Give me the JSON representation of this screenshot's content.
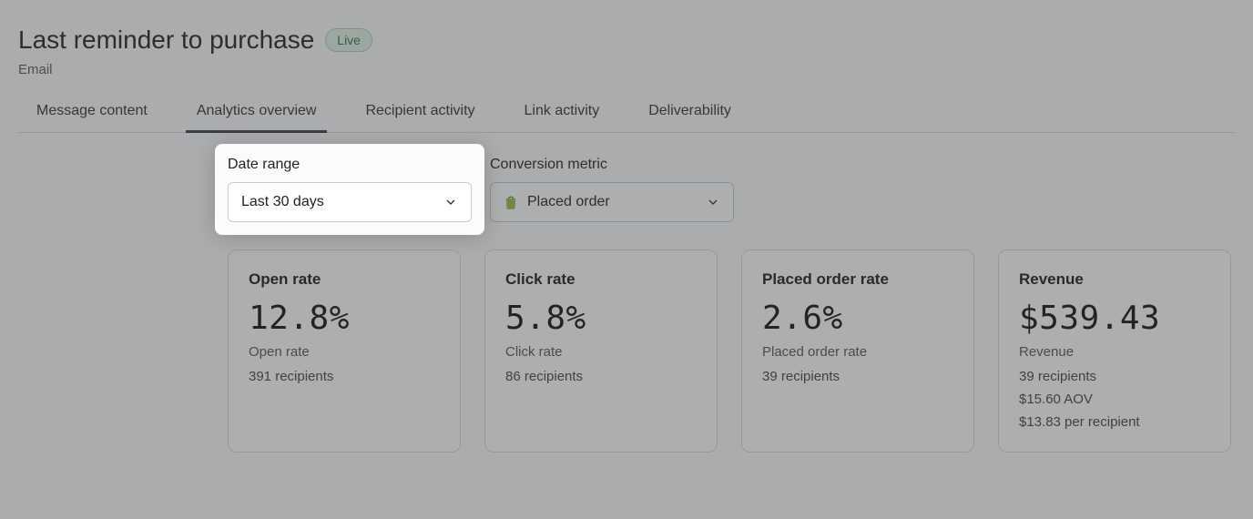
{
  "header": {
    "title": "Last reminder to purchase",
    "status_badge": "Live",
    "channel": "Email"
  },
  "tabs": [
    {
      "label": "Message content",
      "active": false
    },
    {
      "label": "Analytics overview",
      "active": true
    },
    {
      "label": "Recipient activity",
      "active": false
    },
    {
      "label": "Link activity",
      "active": false
    },
    {
      "label": "Deliverability",
      "active": false
    }
  ],
  "filters": {
    "date_range": {
      "label": "Date range",
      "value": "Last 30 days"
    },
    "conversion_metric": {
      "label": "Conversion metric",
      "value": "Placed order",
      "icon": "shopify-bag-icon"
    }
  },
  "metrics": [
    {
      "title": "Open rate",
      "value": "12.8%",
      "subtitle": "Open rate",
      "detail_lines": [
        "391 recipients"
      ]
    },
    {
      "title": "Click rate",
      "value": "5.8%",
      "subtitle": "Click rate",
      "detail_lines": [
        "86 recipients"
      ]
    },
    {
      "title": "Placed order rate",
      "value": "2.6%",
      "subtitle": "Placed order rate",
      "detail_lines": [
        "39 recipients"
      ]
    },
    {
      "title": "Revenue",
      "value": "$539.43",
      "subtitle": "Revenue",
      "detail_lines": [
        "39 recipients",
        "$15.60 AOV",
        "$13.83 per recipient"
      ]
    }
  ],
  "spotlight": {
    "target": "date-range-filter"
  }
}
